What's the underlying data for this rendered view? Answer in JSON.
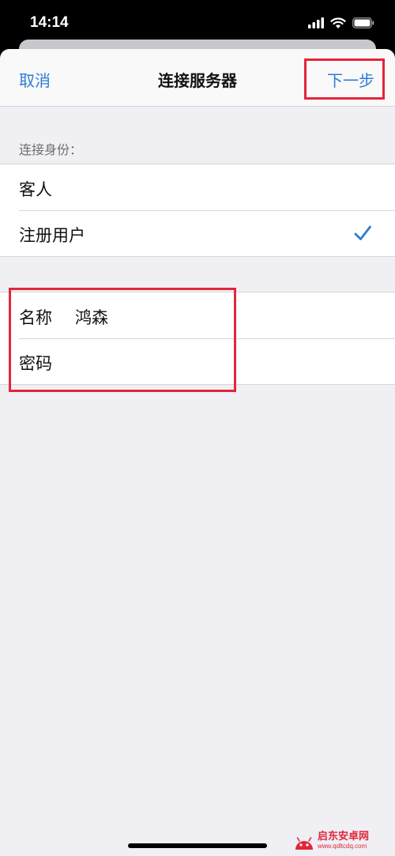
{
  "status_bar": {
    "time": "14:14",
    "icons": [
      "signal-icon",
      "wifi-icon",
      "battery-icon"
    ]
  },
  "nav": {
    "cancel_label": "取消",
    "title": "连接服务器",
    "next_label": "下一步"
  },
  "identity_section": {
    "header": "连接身份：",
    "options": [
      {
        "label": "客人",
        "selected": false
      },
      {
        "label": "注册用户",
        "selected": true
      }
    ]
  },
  "credentials": {
    "name_label": "名称",
    "name_value": "鸿森",
    "password_label": "密码",
    "password_value": ""
  },
  "watermark": {
    "brand": "启东安卓网",
    "url": "www.qdltcdq.com"
  },
  "colors": {
    "accent": "#2f7bd6",
    "annotation": "#e2263a",
    "background": "#efeff4"
  }
}
